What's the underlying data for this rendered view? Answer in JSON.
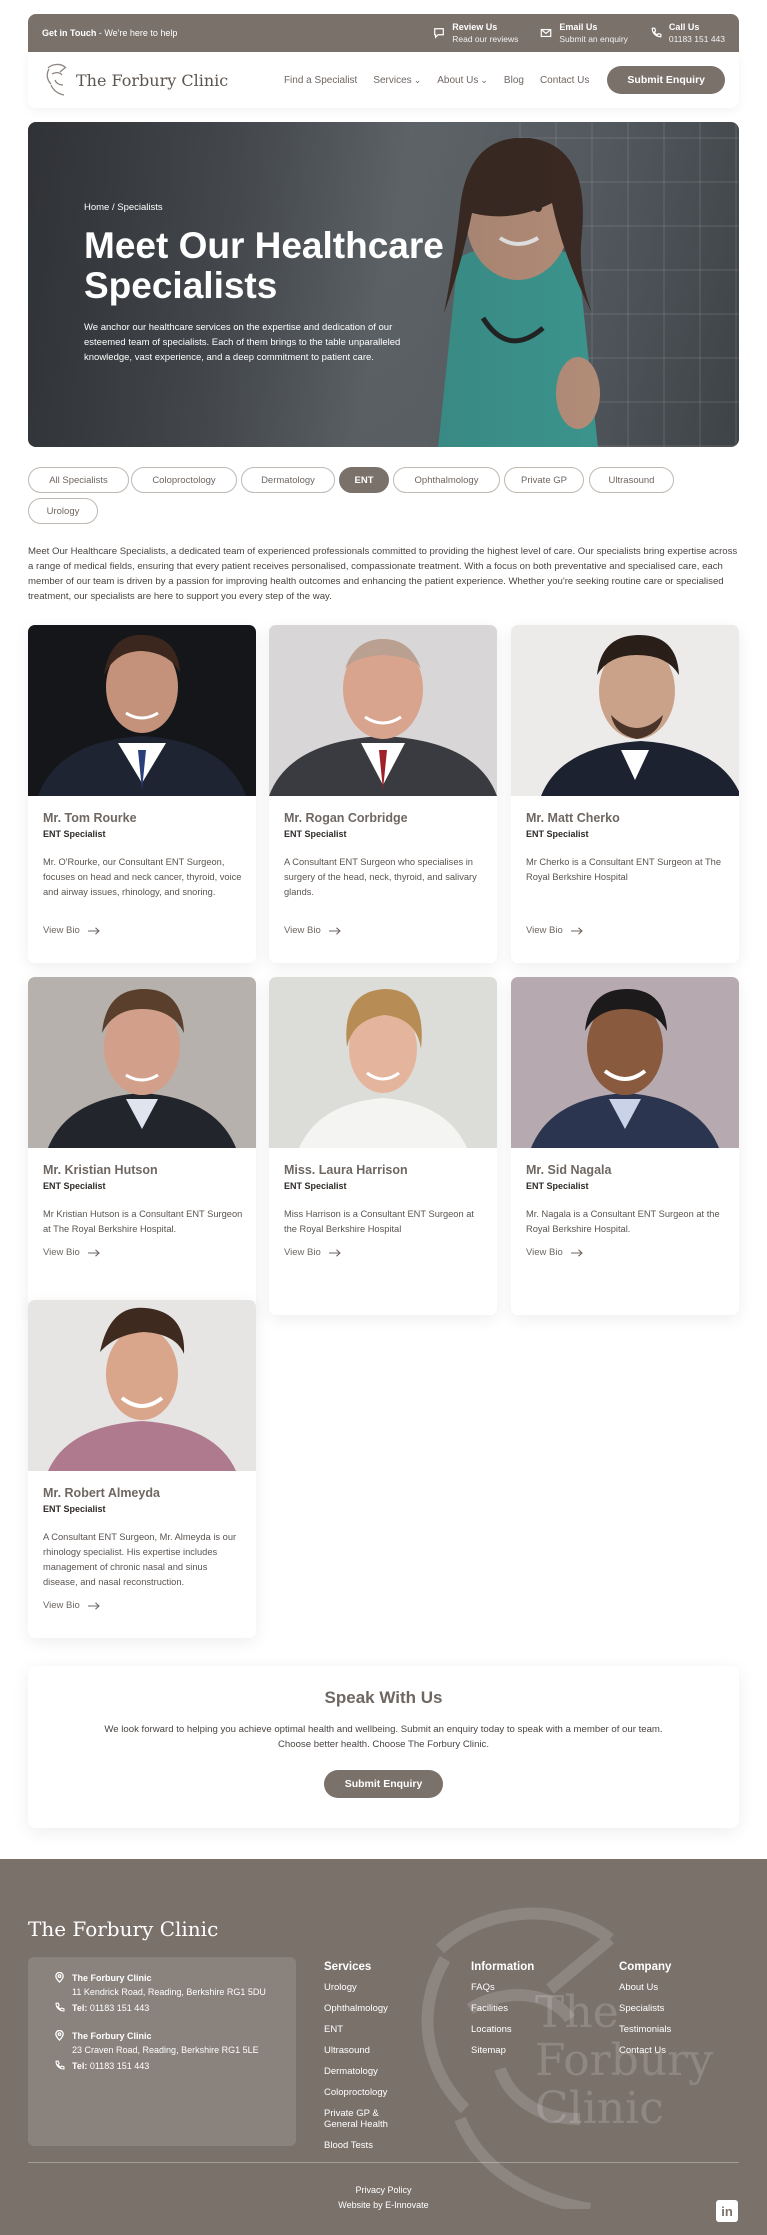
{
  "topbar": {
    "get_in_touch": "Get in Touch",
    "here_to_help": " - We're here to help",
    "review": {
      "title": "Review Us",
      "sub": "Read our reviews"
    },
    "email": {
      "title": "Email Us",
      "sub": "Submit an enquiry"
    },
    "call": {
      "title": "Call Us",
      "sub": "01183 151 443"
    }
  },
  "nav": {
    "logo": "The Forbury Clinic",
    "links": [
      "Find a Specialist",
      "Services",
      "About Us",
      "Blog",
      "Contact Us"
    ],
    "cta": "Submit Enquiry"
  },
  "hero": {
    "breadcrumb": "Home / Specialists",
    "title": "Meet Our Healthcare Specialists",
    "text": "We anchor our healthcare services on the expertise and dedication of our esteemed team of specialists. Each of them brings to the table unparalleled knowledge, vast experience, and a deep commitment to patient care."
  },
  "filters": [
    "All Specialists",
    "Coloproctology",
    "Dermatology",
    "ENT",
    "Ophthalmology",
    "Private GP",
    "Ultrasound",
    "Urology"
  ],
  "active_filter": "ENT",
  "intro": "Meet Our Healthcare Specialists, a dedicated team of experienced professionals committed to providing the highest level of care. Our specialists bring expertise across a range of medical fields, ensuring that every patient receives personalised, compassionate treatment. With a focus on both preventative and specialised care, each member of our team is driven by a passion for improving health outcomes and enhancing the patient experience. Whether you're seeking routine care or specialised treatment, our specialists are here to support you every step of the way.",
  "specialists": [
    {
      "name": "Mr. Tom Rourke",
      "role": "ENT Specialist",
      "desc": "Mr. O'Rourke, our Consultant ENT Surgeon, focuses on head and neck cancer, thyroid, voice and airway issues, rhinology, and snoring.",
      "bio": "View Bio"
    },
    {
      "name": "Mr. Rogan Corbridge",
      "role": "ENT Specialist",
      "desc": "A Consultant ENT Surgeon who specialises in surgery of the head, neck, thyroid, and salivary glands.",
      "bio": "View Bio"
    },
    {
      "name": "Mr. Matt Cherko",
      "role": "ENT Specialist",
      "desc": "Mr Cherko is a Consultant ENT Surgeon at The Royal Berkshire Hospital",
      "bio": "View Bio"
    },
    {
      "name": "Mr. Kristian Hutson",
      "role": "ENT Specialist",
      "desc": "Mr Kristian Hutson is a Consultant ENT Surgeon at The Royal Berkshire Hospital.",
      "bio": "View Bio"
    },
    {
      "name": "Miss. Laura Harrison",
      "role": "ENT Specialist",
      "desc": "Miss Harrison is a Consultant ENT Surgeon at the Royal Berkshire Hospital",
      "bio": "View Bio"
    },
    {
      "name": "Mr. Sid Nagala",
      "role": "ENT Specialist",
      "desc": "Mr. Nagala is a Consultant ENT Surgeon at the Royal Berkshire Hospital.",
      "bio": "View Bio"
    },
    {
      "name": "Mr. Robert Almeyda",
      "role": "ENT Specialist",
      "desc": "A Consultant ENT Surgeon, Mr. Almeyda is our rhinology specialist. His expertise includes management of chronic nasal and sinus disease, and nasal reconstruction.",
      "bio": "View Bio"
    }
  ],
  "speak": {
    "title": "Speak With Us",
    "text": "We look forward to helping you achieve optimal health and wellbeing. Submit an enquiry today to speak with a member of our team. Choose better health. Choose The Forbury Clinic.",
    "cta": "Submit Enquiry"
  },
  "footer": {
    "logo": "The Forbury Clinic",
    "watermark": [
      "The",
      "Forbury",
      "Clinic"
    ],
    "locations": [
      {
        "name": "The Forbury Clinic",
        "address": "11 Kendrick Road, Reading, Berkshire RG1 5DU",
        "tel_label": "Tel:",
        "tel": " 01183 151 443"
      },
      {
        "name": "The Forbury Clinic",
        "address": "23 Craven Road, Reading, Berkshire RG1 5LE",
        "tel_label": "Tel:",
        "tel": " 01183 151 443"
      }
    ],
    "services": {
      "title": "Services",
      "items": [
        "Urology",
        "Ophthalmology",
        "ENT",
        "Ultrasound",
        "Dermatology",
        "Coloproctology",
        "Private GP & General Health",
        "Blood Tests"
      ]
    },
    "information": {
      "title": "Information",
      "items": [
        "FAQs",
        "Facilities",
        "Locations",
        "Sitemap"
      ]
    },
    "company": {
      "title": "Company",
      "items": [
        "About Us",
        "Specialists",
        "Testimonials",
        "Contact Us"
      ]
    },
    "privacy": "Privacy Policy",
    "credit": "Website by E-Innovate",
    "social": "in"
  },
  "colors": {
    "brand": "#7a716b",
    "text": "#3b3633",
    "background": "#ffffff"
  }
}
